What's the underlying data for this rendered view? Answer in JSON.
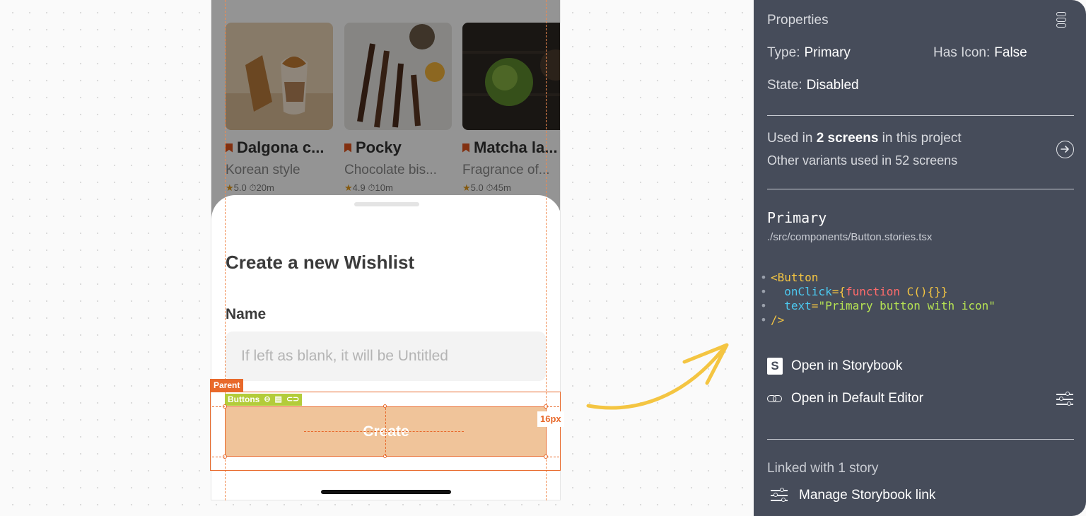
{
  "feed": {
    "cards": [
      {
        "title": "Dalgona c...",
        "subtitle": "Korean style",
        "rating": "5.0",
        "time": "20m"
      },
      {
        "title": "Pocky",
        "subtitle": "Chocolate bis...",
        "rating": "4.9",
        "time": "10m"
      },
      {
        "title": "Matcha la...",
        "subtitle": "Fragrance of...",
        "rating": "5.0",
        "time": "45m"
      }
    ]
  },
  "sheet": {
    "title": "Create a new Wishlist",
    "name_label": "Name",
    "name_placeholder": "If left as blank, it will be Untitled",
    "create_button": "Create"
  },
  "overlay": {
    "parent_tag": "Parent",
    "buttons_tag": "Buttons",
    "spacing_label": "16px"
  },
  "properties": {
    "title": "Properties",
    "type_key": "Type:",
    "type_value": "Primary",
    "has_icon_key": "Has Icon:",
    "has_icon_value": "False",
    "state_key": "State:",
    "state_value": "Disabled",
    "used_prefix": "Used in",
    "used_count": "2 screens",
    "used_suffix": "in this project",
    "other_variants": "Other variants used in 52 screens",
    "component_name": "Primary",
    "component_path": "./src/components/Button.stories.tsx",
    "code": {
      "tag_open": "<Button",
      "attr1": "onClick",
      "attr1_eq": "={",
      "attr1_kw": "function",
      "attr1_fn": " C(){}}",
      "attr2": "text",
      "attr2_eq": "=",
      "attr2_val": "\"Primary button with icon\"",
      "tag_close": "/>"
    },
    "open_storybook": "Open in Storybook",
    "open_editor": "Open in Default Editor",
    "linked": "Linked with 1 story",
    "manage_link": "Manage Storybook link"
  },
  "colors": {
    "accent": "#e8692b",
    "button_disabled": "#f0c49a",
    "panel_bg": "#464c5a",
    "arrow": "#f4c542"
  }
}
